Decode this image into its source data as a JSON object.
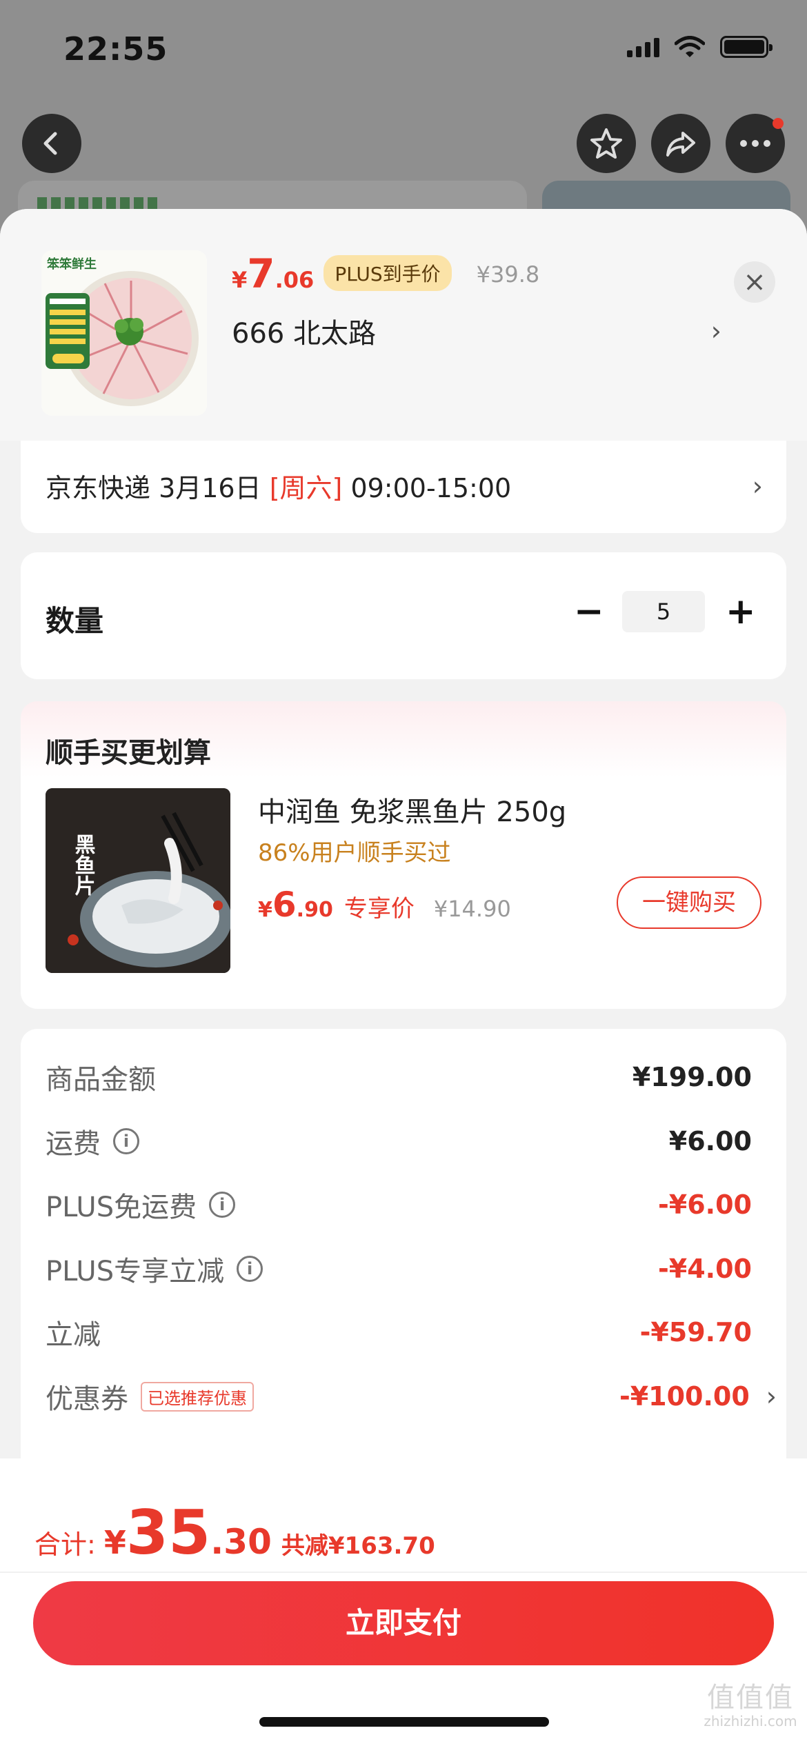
{
  "status_bar": {
    "time": "22:55"
  },
  "top_nav": {
    "back_icon": "chevron-left-icon",
    "favorite_icon": "star-icon",
    "share_icon": "share-icon",
    "more_icon": "more-icon"
  },
  "product": {
    "price_yen": "¥",
    "price_int": "7",
    "price_dec": ".06",
    "plus_tag": "PLUS到手价",
    "original_price": "¥39.8",
    "address": "666  北太路",
    "image_brand_text": "笨笨鲜生"
  },
  "delivery": {
    "prefix": "京东快递 3月16日 ",
    "weekday": "[周六]",
    "time_window": " 09:00-15:00"
  },
  "quantity": {
    "label": "数量",
    "value": "5",
    "minus": "−",
    "plus": "+"
  },
  "upsell": {
    "title": "顺手买更划算",
    "name": "中润鱼 免浆黑鱼片 250g",
    "note": "86%用户顺手买过",
    "price_yen": "¥",
    "price_int": "6",
    "price_dec": ".90",
    "price_label": "专享价",
    "original_price": "¥14.90",
    "buy_button": "一键购买",
    "image_text": "黑鱼片"
  },
  "summary": {
    "rows": [
      {
        "label": "商品金额",
        "value": "¥199.00"
      },
      {
        "label": "运费",
        "value": "¥6.00"
      },
      {
        "label": "PLUS免运费",
        "value": "-¥6.00"
      },
      {
        "label": "PLUS专享立减",
        "value": "-¥4.00"
      },
      {
        "label": "立减",
        "value": "-¥59.70"
      },
      {
        "label": "优惠券",
        "value": "-¥100.00"
      }
    ],
    "coupon_tag": "已选推荐优惠",
    "info_icon": "info-icon"
  },
  "footer": {
    "total_label": "合计:",
    "total_yen": "¥",
    "total_int": "35",
    "total_dec": ".30",
    "total_saved": "共减¥163.70",
    "pay_button": "立即支付"
  },
  "watermark": {
    "glyphs": "值值值",
    "site": "zhizhizhi.com"
  },
  "colors": {
    "accent_red": "#e8392b",
    "upsell_note": "#c8811e",
    "plus_tag_bg": "#fbe3a8"
  }
}
